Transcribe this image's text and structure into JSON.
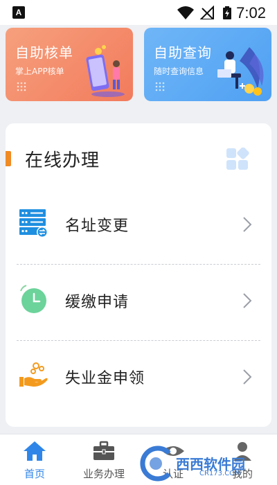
{
  "status_bar": {
    "left_icon_letter": "A",
    "time": "7:02",
    "icons": [
      "wifi-icon",
      "signal-off-icon",
      "battery-charging-icon"
    ]
  },
  "top_cards": [
    {
      "title": "自助核单",
      "subtitle": "掌上APP核单",
      "color": "#f27b5c"
    },
    {
      "title": "自助查询",
      "subtitle": "随时查询信息",
      "color": "#4fa0f3"
    }
  ],
  "panel": {
    "title": "在线办理",
    "accent_color": "#f08a24",
    "items": [
      {
        "label": "名址变更",
        "icon": "server-transfer-icon"
      },
      {
        "label": "缓缴申请",
        "icon": "clock-icon"
      },
      {
        "label": "失业金申领",
        "icon": "hand-coins-icon"
      }
    ]
  },
  "bottom_nav": {
    "active_color": "#2f86e8",
    "items": [
      {
        "label": "首页",
        "icon": "home-icon",
        "active": true
      },
      {
        "label": "业务办理",
        "icon": "briefcase-icon",
        "active": false
      },
      {
        "label": "认证",
        "icon": "eye-icon",
        "active": false
      },
      {
        "label": "我的",
        "icon": "user-icon",
        "active": false
      }
    ]
  },
  "watermark": {
    "text": "西西软件园",
    "url": "CR173.COM"
  }
}
